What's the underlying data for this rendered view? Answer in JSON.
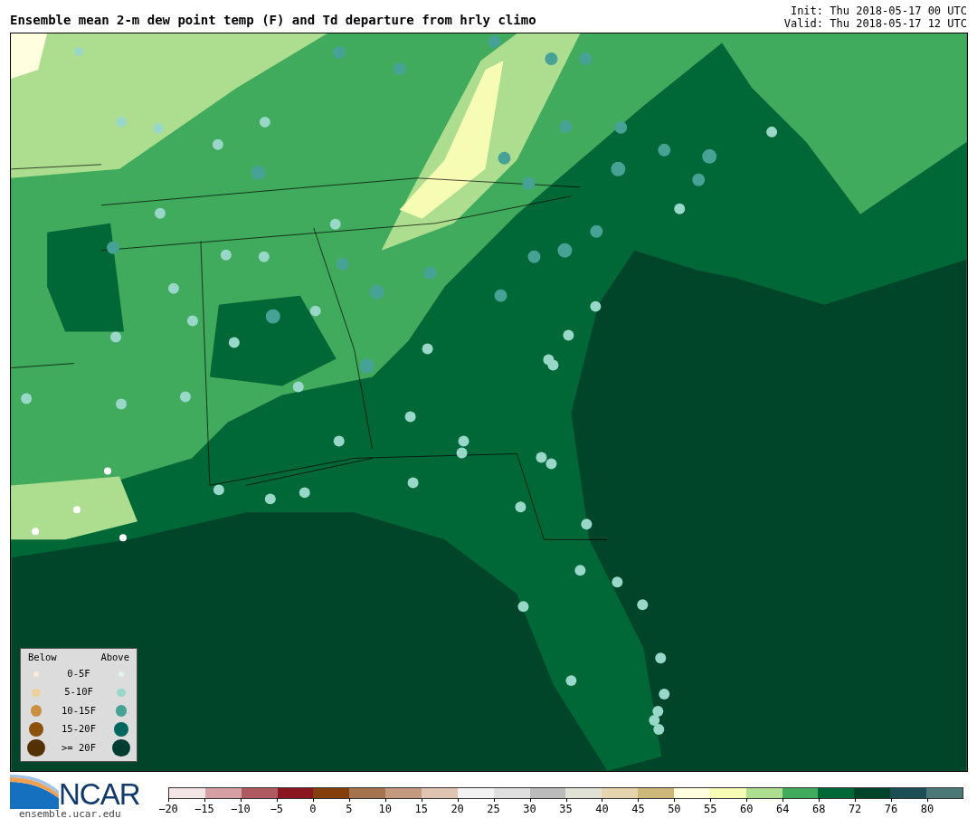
{
  "title": "Ensemble mean 2-m dew point temp (F) and Td departure from hrly climo",
  "init": "Init: Thu 2018-05-17 00 UTC",
  "valid": "Valid: Thu 2018-05-17 12 UTC",
  "legend": {
    "below_label": "Below",
    "above_label": "Above",
    "rows": [
      {
        "label": "0-5F",
        "below": {
          "color": "#faebd7"
        },
        "above": {
          "color": "#e0f3f0"
        }
      },
      {
        "label": "5-10F",
        "below": {
          "color": "#ecd29a"
        },
        "above": {
          "color": "#99d8c9"
        }
      },
      {
        "label": "10-15F",
        "below": {
          "color": "#c99042"
        },
        "above": {
          "color": "#45a294"
        }
      },
      {
        "label": "15-20F",
        "below": {
          "color": "#8c510a"
        },
        "above": {
          "color": "#01665e"
        }
      },
      {
        "label": ">= 20F",
        "below": {
          "color": "#543005"
        },
        "above": {
          "color": "#003c30"
        }
      }
    ]
  },
  "logo": {
    "text": "NCAR",
    "url": "ensemble.ucar.edu"
  },
  "colorbar": {
    "segments": [
      {
        "color": "#f3e4e5"
      },
      {
        "color": "#d59fa4"
      },
      {
        "color": "#ae5a60"
      },
      {
        "color": "#8c1620"
      },
      {
        "color": "#843f0d"
      },
      {
        "color": "#a6734f"
      },
      {
        "color": "#c49a7e"
      },
      {
        "color": "#dfc4b1"
      },
      {
        "color": "#f2f2f2"
      },
      {
        "color": "#dfdfdf"
      },
      {
        "color": "#bbbbbb"
      },
      {
        "color": "#e1e1d6"
      },
      {
        "color": "#e5d4ae"
      },
      {
        "color": "#cdb87a"
      },
      {
        "color": "#ffffdf"
      },
      {
        "color": "#f7fcb4"
      },
      {
        "color": "#addd8e"
      },
      {
        "color": "#41ab5d"
      },
      {
        "color": "#006837"
      },
      {
        "color": "#004529"
      },
      {
        "color": "#1b4f55"
      },
      {
        "color": "#4d7878"
      }
    ],
    "ticks": [
      "−20",
      "−15",
      "−10",
      "−5",
      "0",
      "5",
      "10",
      "15",
      "20",
      "25",
      "30",
      "35",
      "40",
      "45",
      "50",
      "55",
      "60",
      "64",
      "68",
      "72",
      "76",
      "80"
    ]
  }
}
